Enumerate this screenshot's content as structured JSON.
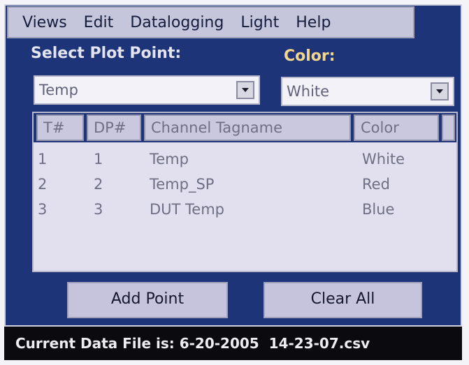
{
  "menu": {
    "items": [
      {
        "label": "Views"
      },
      {
        "label": "Edit"
      },
      {
        "label": "Datalogging"
      },
      {
        "label": "Light"
      },
      {
        "label": "Help"
      }
    ]
  },
  "plot_point": {
    "label": "Select Plot Point:",
    "value": "Temp"
  },
  "color": {
    "label": "Color:",
    "value": "White"
  },
  "table": {
    "headers": [
      "T#",
      "DP#",
      "Channel Tagname",
      "Color"
    ],
    "rows": [
      {
        "t": "1",
        "dp": "1",
        "tag": "Temp",
        "color": "White"
      },
      {
        "t": "2",
        "dp": "2",
        "tag": "Temp_SP",
        "color": "Red"
      },
      {
        "t": "3",
        "dp": "3",
        "tag": "DUT Temp",
        "color": "Blue"
      }
    ]
  },
  "buttons": {
    "add": "Add Point",
    "clear": "Clear All"
  },
  "status": {
    "text": "Current Data File is: 6-20-2005  14-23-07.csv"
  },
  "theme": {
    "panel_bg": "#1e3478",
    "color_label": "#f2d58e",
    "status_bg": "#0b0b0f"
  }
}
